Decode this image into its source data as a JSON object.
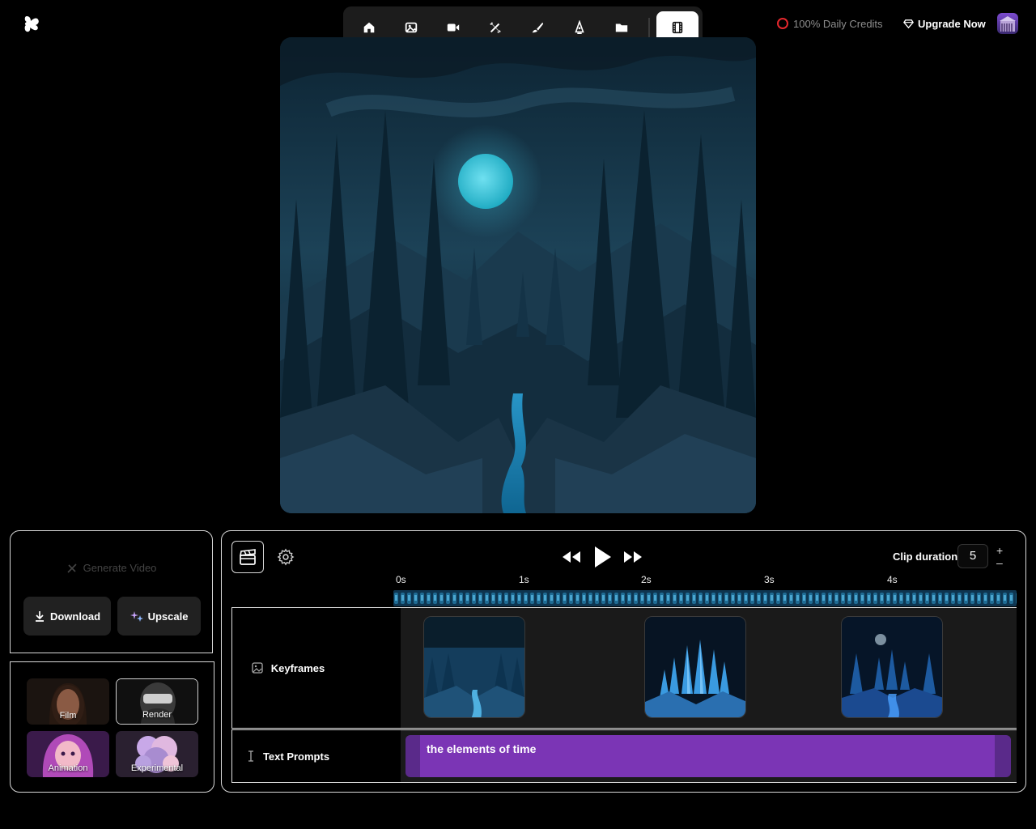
{
  "header": {
    "logo_name": "app-logo",
    "toolbar": [
      {
        "name": "home",
        "icon": "home-icon"
      },
      {
        "name": "image",
        "icon": "image-icon"
      },
      {
        "name": "video",
        "icon": "video-camera-icon"
      },
      {
        "name": "magic",
        "icon": "magic-wand-icon"
      },
      {
        "name": "brush",
        "icon": "brush-icon"
      },
      {
        "name": "vector",
        "icon": "pen-nib-icon"
      },
      {
        "name": "library",
        "icon": "folder-icon"
      },
      {
        "name": "video-editor",
        "icon": "film-icon",
        "active": true
      }
    ],
    "credits_text": "100% Daily Credits",
    "upgrade_label": "Upgrade Now"
  },
  "actions": {
    "generate_video_label": "Generate Video",
    "download_label": "Download",
    "upscale_label": "Upscale"
  },
  "presets": [
    {
      "label": "Film"
    },
    {
      "label": "Render"
    },
    {
      "label": "Animation"
    },
    {
      "label": "Experimental"
    }
  ],
  "timeline": {
    "clip_duration_label": "Clip duration",
    "clip_duration_value": "5",
    "plus_label": "+",
    "minus_label": "–",
    "ticks": [
      "0s",
      "1s",
      "2s",
      "3s",
      "4s"
    ],
    "tracks": {
      "keyframes_label": "Keyframes",
      "text_prompts_label": "Text Prompts"
    },
    "prompt_text": "the elements of time"
  },
  "colors": {
    "background": "#000000",
    "accent_purple": "#7b35b5",
    "credit_ring": "#e5272d"
  }
}
